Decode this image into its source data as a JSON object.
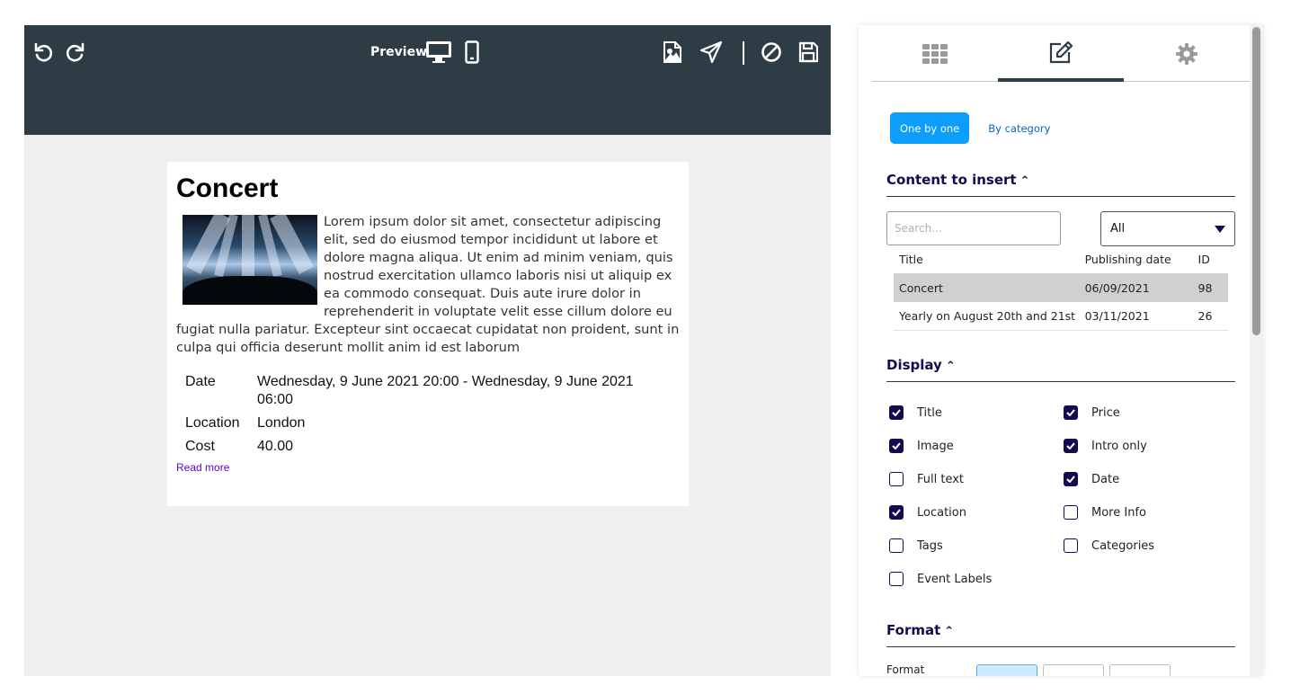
{
  "toolbar": {
    "preview_label": "Preview",
    "icons": [
      "undo-icon",
      "redo-icon",
      "desktop-icon",
      "mobile-icon",
      "image-icon",
      "send-icon",
      "cancel-icon",
      "save-icon"
    ]
  },
  "article": {
    "title": "Concert",
    "body": "Lorem ipsum dolor sit amet, consectetur adipiscing elit, sed do eiusmod tempor incididunt ut labore et dolore magna aliqua. Ut enim ad minim veniam, quis nostrud ex­ercitation ullamco laboris nisi ut aliquip ex ea commodo consequat. Duis aute irure dolor in reprehenderit in voluptate velit esse cillum dolore eu fugiat nulla pariatur. Excepteur sint occaecat cupidatat non proident, sunt in culpa qui officia deserunt mollit anim id est laborum",
    "details": [
      {
        "label": "Date",
        "value": "Wednesday, 9 June 2021 20:00 - Wednesday, 9 June 2021 06:00"
      },
      {
        "label": "Location",
        "value": "London"
      },
      {
        "label": "Cost",
        "value": "40.00"
      }
    ],
    "read_more": "Read more"
  },
  "panel": {
    "tabs": [
      {
        "icon": "grid-icon",
        "active": false
      },
      {
        "icon": "edit-icon",
        "active": true
      },
      {
        "icon": "gear-icon",
        "active": false
      }
    ],
    "mode": {
      "one_by_one": "One by one",
      "by_category": "By category"
    },
    "content_section": "Content to insert",
    "search_placeholder": "Search...",
    "filter_value": "All",
    "table": {
      "headers": [
        "Title",
        "Publishing date",
        "ID"
      ],
      "rows": [
        {
          "title": "Concert",
          "date": "06/09/2021",
          "id": "98",
          "selected": true
        },
        {
          "title": "Yearly on August 20th and 21st",
          "date": "03/11/2021",
          "id": "26",
          "selected": false
        }
      ]
    },
    "display_section": "Display",
    "display_options": [
      {
        "label": "Title",
        "checked": true
      },
      {
        "label": "Price",
        "checked": true
      },
      {
        "label": "Image",
        "checked": true
      },
      {
        "label": "Intro only",
        "checked": true
      },
      {
        "label": "Full text",
        "checked": false
      },
      {
        "label": "Date",
        "checked": true
      },
      {
        "label": "Location",
        "checked": true
      },
      {
        "label": "More Info",
        "checked": false
      },
      {
        "label": "Tags",
        "checked": false
      },
      {
        "label": "Categories",
        "checked": false
      },
      {
        "label": "Event Labels",
        "checked": false
      }
    ],
    "format_section": "Format",
    "format_label": "Format",
    "colors": {
      "toolbar": "#2e3d45",
      "accent": "#0d9efc",
      "heading": "#140a50",
      "link": "#5b00d6"
    }
  }
}
